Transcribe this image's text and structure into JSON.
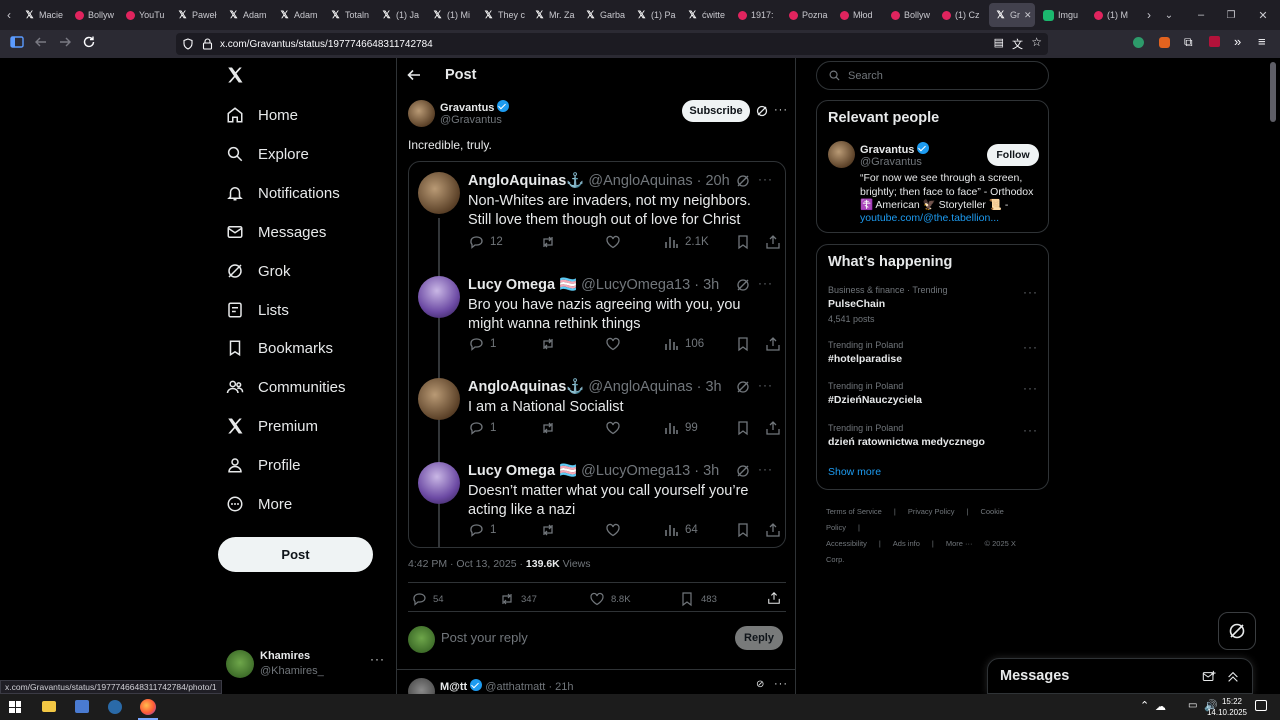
{
  "browser": {
    "tabs": [
      {
        "label": "Macie",
        "icon": "x"
      },
      {
        "label": "Bollyw",
        "icon": "yt"
      },
      {
        "label": "YouTu",
        "icon": "yt"
      },
      {
        "label": "Paweł",
        "icon": "x"
      },
      {
        "label": "Adam",
        "icon": "x"
      },
      {
        "label": "Adam",
        "icon": "x"
      },
      {
        "label": "Totaln",
        "icon": "x"
      },
      {
        "label": "(1) Ja",
        "icon": "x"
      },
      {
        "label": "(1) Mi",
        "icon": "x"
      },
      {
        "label": "They c",
        "icon": "x"
      },
      {
        "label": "Mr. Za",
        "icon": "x"
      },
      {
        "label": "Garba",
        "icon": "x"
      },
      {
        "label": "(1) Pa",
        "icon": "x"
      },
      {
        "label": "ćwitte",
        "icon": "x"
      },
      {
        "label": "1917:",
        "icon": "yt"
      },
      {
        "label": "Pozna",
        "icon": "yt"
      },
      {
        "label": "Młod",
        "icon": "yt"
      },
      {
        "label": "Bollyw",
        "icon": "yt"
      },
      {
        "label": "(1) Cz",
        "icon": "yt"
      },
      {
        "label": "Gr",
        "icon": "x",
        "active": true
      },
      {
        "label": "Imgu",
        "icon": "imgur"
      },
      {
        "label": "(1) M",
        "icon": "yt"
      }
    ],
    "url": "x.com/Gravantus/status/1977746648311742784",
    "status_url": "x.com/Gravantus/status/1977746648311742784/photo/1"
  },
  "nav": {
    "items": [
      {
        "label": "Home",
        "icon": "home-icon"
      },
      {
        "label": "Explore",
        "icon": "search-icon"
      },
      {
        "label": "Notifications",
        "icon": "bell-icon"
      },
      {
        "label": "Messages",
        "icon": "mail-icon"
      },
      {
        "label": "Grok",
        "icon": "grok-icon"
      },
      {
        "label": "Lists",
        "icon": "list-icon"
      },
      {
        "label": "Bookmarks",
        "icon": "bookmark-icon"
      },
      {
        "label": "Communities",
        "icon": "people-icon"
      },
      {
        "label": "Premium",
        "icon": "x-logo-icon"
      },
      {
        "label": "Profile",
        "icon": "person-icon"
      },
      {
        "label": "More",
        "icon": "more-circle-icon"
      }
    ],
    "post_label": "Post",
    "account": {
      "name": "Khamires",
      "handle": "@Khamires_"
    }
  },
  "post": {
    "header_title": "Post",
    "author": {
      "name": "Gravantus",
      "handle": "@Gravantus"
    },
    "subscribe_label": "Subscribe",
    "text": "Incredible, truly.",
    "embedded": [
      {
        "name": "AngloAquinas⚓",
        "handle": "@AngloAquinas",
        "time": "20h",
        "text": "Non-Whites are invaders, not my neighbors. Still love them though out of love for Christ",
        "replies": "12",
        "views": "2.1K",
        "avatar": "brown"
      },
      {
        "name": "Lucy Omega 🏳️‍⚧️",
        "handle": "@LucyOmega13",
        "time": "3h",
        "text": "Bro you have nazis agreeing with you, you might wanna rethink things",
        "replies": "1",
        "views": "106",
        "avatar": "purple"
      },
      {
        "name": "AngloAquinas⚓",
        "handle": "@AngloAquinas",
        "time": "3h",
        "text": "I am a National Socialist",
        "replies": "1",
        "views": "99",
        "avatar": "brown"
      },
      {
        "name": "Lucy Omega 🏳️‍⚧️",
        "handle": "@LucyOmega13",
        "time": "3h",
        "text": "Doesn’t matter what you call yourself you’re acting like a nazi",
        "replies": "1",
        "views": "64",
        "avatar": "purple"
      }
    ],
    "meta_time": "4:42 PM · Oct 13, 2025 · ",
    "meta_views": "139.6K",
    "meta_views_label": " Views",
    "stats": {
      "replies": "54",
      "reposts": "347",
      "likes": "8.8K",
      "bookmarks": "483"
    },
    "reply_placeholder": "Post your reply",
    "reply_button": "Reply",
    "next_reply": {
      "name": "M@tt",
      "handle": "@atthatmatt",
      "time": "21h"
    }
  },
  "right": {
    "search_placeholder": "Search",
    "relevant_title": "Relevant people",
    "person": {
      "name": "Gravantus",
      "handle": "@Gravantus",
      "bio": "“For now we see through a screen, brightly; then face to face” - Orthodox ☦️ American 🦅 Storyteller 📜 -",
      "link": "youtube.com/@the.tabellion...",
      "follow_label": "Follow"
    },
    "happening_title": "What’s happening",
    "trends": [
      {
        "context": "Business & finance · Trending",
        "title": "PulseChain",
        "count": "4,541 posts"
      },
      {
        "context": "Trending in Poland",
        "title": "#hotelparadise",
        "count": ""
      },
      {
        "context": "Trending in Poland",
        "title": "#DzieńNauczyciela",
        "count": ""
      },
      {
        "context": "Trending in Poland",
        "title": "dzień ratownictwa medycznego",
        "count": ""
      }
    ],
    "show_more": "Show more",
    "footer": [
      "Terms of Service",
      "|",
      "Privacy Policy",
      "|",
      "Cookie Policy",
      "|",
      "Accessibility",
      "|",
      "Ads info",
      "|",
      "More ···",
      "© 2025 X Corp."
    ],
    "messages_title": "Messages"
  },
  "taskbar": {
    "time": "15:22",
    "date": "14.10.2025"
  }
}
